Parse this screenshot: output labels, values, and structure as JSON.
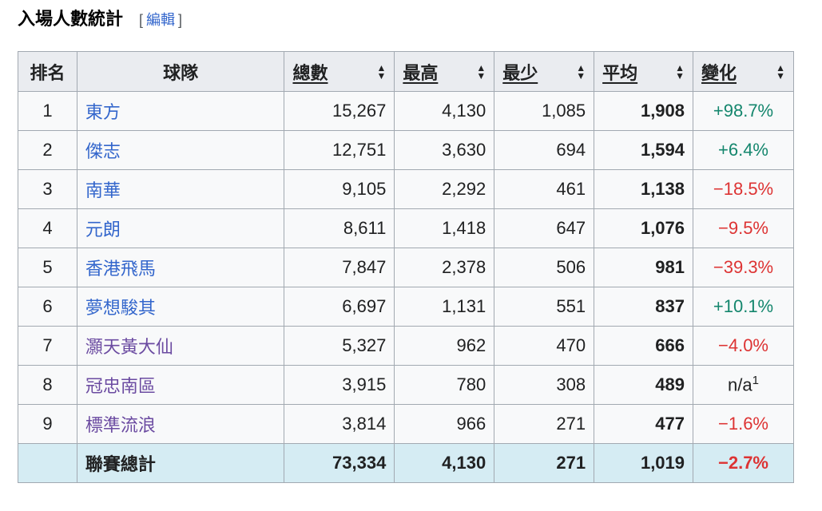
{
  "heading": {
    "title": "入場人數統計",
    "edit_open": "[",
    "edit_label": "編輯",
    "edit_close": "]"
  },
  "columns": {
    "rank": "排名",
    "team": "球隊",
    "total": "總數",
    "high": "最高",
    "low": "最少",
    "avg": "平均",
    "change": "變化"
  },
  "rows": [
    {
      "rank": "1",
      "team": "東方",
      "total": "15,267",
      "high": "4,130",
      "low": "1,085",
      "avg": "1,908",
      "change": "+98.7%"
    },
    {
      "rank": "2",
      "team": "傑志",
      "total": "12,751",
      "high": "3,630",
      "low": "694",
      "avg": "1,594",
      "change": "+6.4%"
    },
    {
      "rank": "3",
      "team": "南華",
      "total": "9,105",
      "high": "2,292",
      "low": "461",
      "avg": "1,138",
      "change": "−18.5%"
    },
    {
      "rank": "4",
      "team": "元朗",
      "total": "8,611",
      "high": "1,418",
      "low": "647",
      "avg": "1,076",
      "change": "−9.5%"
    },
    {
      "rank": "5",
      "team": "香港飛馬",
      "total": "7,847",
      "high": "2,378",
      "low": "506",
      "avg": "981",
      "change": "−39.3%"
    },
    {
      "rank": "6",
      "team": "夢想駿其",
      "total": "6,697",
      "high": "1,131",
      "low": "551",
      "avg": "837",
      "change": "+10.1%"
    },
    {
      "rank": "7",
      "team": "灝天黃大仙",
      "total": "5,327",
      "high": "962",
      "low": "470",
      "avg": "666",
      "change": "−4.0%"
    },
    {
      "rank": "8",
      "team": "冠忠南區",
      "total": "3,915",
      "high": "780",
      "low": "308",
      "avg": "489",
      "change": "n/a",
      "note": "1"
    },
    {
      "rank": "9",
      "team": "標準流浪",
      "total": "3,814",
      "high": "966",
      "low": "271",
      "avg": "477",
      "change": "−1.6%"
    }
  ],
  "totals": {
    "label": "聯賽總計",
    "total": "73,334",
    "high": "4,130",
    "low": "271",
    "avg": "1,019",
    "change": "−2.7%"
  },
  "colors": {
    "link": "#3366cc",
    "visited": "#6b4ba1",
    "positive": "#14866d",
    "negative": "#d33333",
    "header_bg": "#eaecf0",
    "total_bg": "#d5ecf3"
  }
}
